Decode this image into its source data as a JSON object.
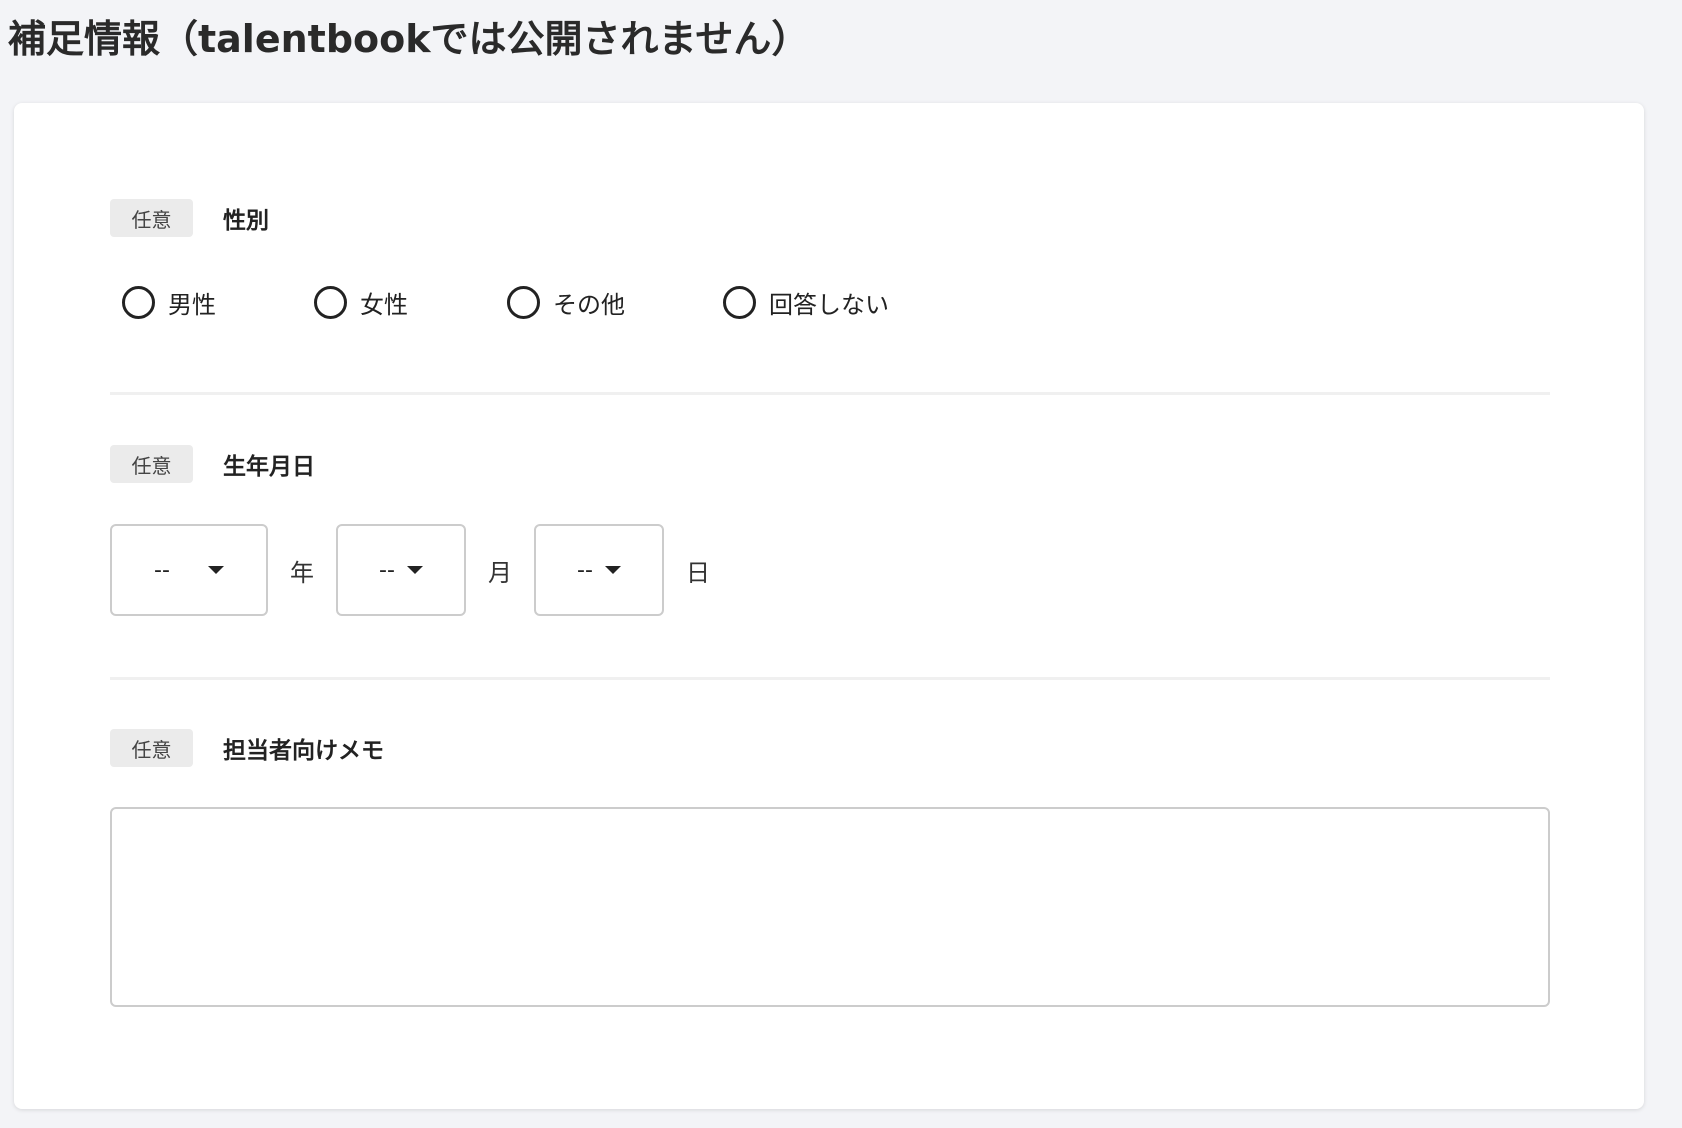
{
  "section_title": "補足情報（talentbookでは公開されません）",
  "gender_field": {
    "badge": "任意",
    "label": "性別",
    "options": [
      "男性",
      "女性",
      "その他",
      "回答しない"
    ]
  },
  "birthdate_field": {
    "badge": "任意",
    "label": "生年月日",
    "year": {
      "value": "--",
      "unit": "年"
    },
    "month": {
      "value": "--",
      "unit": "月"
    },
    "day": {
      "value": "--",
      "unit": "日"
    }
  },
  "memo_field": {
    "badge": "任意",
    "label": "担当者向けメモ",
    "value": ""
  },
  "colors": {
    "page_background": "#f3f4f7",
    "card_background": "#ffffff",
    "badge_background": "#ebebeb",
    "border": "#cccccc",
    "text": "#222222"
  }
}
